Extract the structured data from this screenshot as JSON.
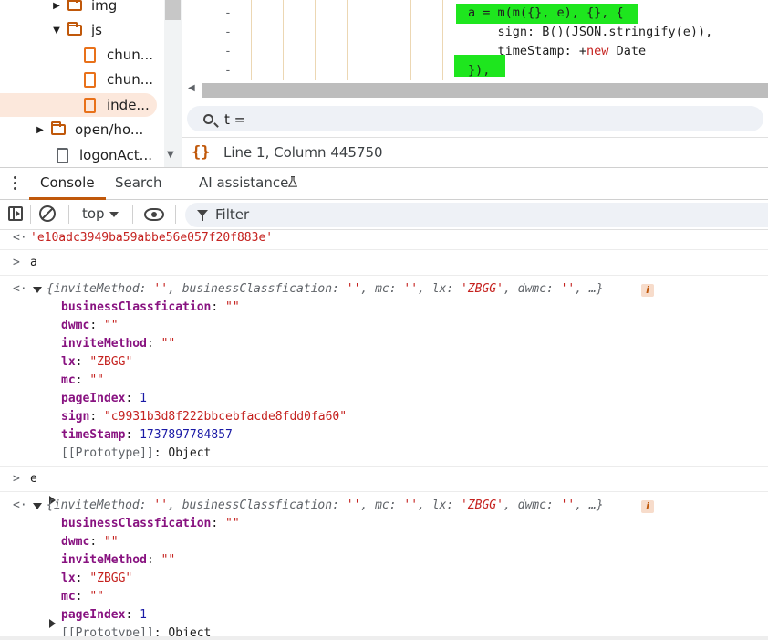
{
  "file_tree": {
    "items": [
      {
        "label": "img",
        "kind": "folder",
        "expanded": false
      },
      {
        "label": "js",
        "kind": "folder",
        "expanded": true
      },
      {
        "label": "chun...",
        "kind": "file"
      },
      {
        "label": "chun...",
        "kind": "file"
      },
      {
        "label": "inde...",
        "kind": "file",
        "selected": true
      },
      {
        "label": "open/ho...",
        "kind": "folder",
        "expanded": false
      },
      {
        "label": "logonAct...",
        "kind": "file"
      }
    ]
  },
  "editor": {
    "gutter": [
      "-",
      "-",
      "-",
      "-"
    ],
    "code_lines": [
      {
        "parts": [
          {
            "t": "a = m(m({}, e), {}, {"
          }
        ]
      },
      {
        "parts": [
          {
            "t": "    sign: B()(JSON.stringify(e)),"
          }
        ]
      },
      {
        "parts": [
          {
            "t": "    timeStamp: +"
          },
          {
            "t": "new",
            "kw": true
          },
          {
            "t": " Date"
          }
        ]
      },
      {
        "parts": [
          {
            "t": "}),"
          }
        ]
      }
    ],
    "search_query": "t =",
    "cursor_position": "Line 1, Column 445750"
  },
  "drawer": {
    "tabs": [
      "Console",
      "Search",
      "AI assistance"
    ],
    "active_tab": "Console"
  },
  "console_toolbar": {
    "context": "top",
    "filter_placeholder": "Filter"
  },
  "console": {
    "hash_result": "'e10adc3949ba59abbe56e057f20f883e'",
    "input_a": "a",
    "input_e": "e",
    "obj_a": {
      "summary": [
        {
          "k": "inviteMethod",
          "v": "''"
        },
        {
          "k": "businessClassfication",
          "v": "''"
        },
        {
          "k": "mc",
          "v": "''"
        },
        {
          "k": "lx",
          "v": "'ZBGG'"
        },
        {
          "k": "dwmc",
          "v": "''"
        }
      ],
      "summary_tail": "…}",
      "props": [
        {
          "k": "businessClassfication",
          "v": "\"\"",
          "type": "str"
        },
        {
          "k": "dwmc",
          "v": "\"\"",
          "type": "str"
        },
        {
          "k": "inviteMethod",
          "v": "\"\"",
          "type": "str"
        },
        {
          "k": "lx",
          "v": "\"ZBGG\"",
          "type": "str"
        },
        {
          "k": "mc",
          "v": "\"\"",
          "type": "str"
        },
        {
          "k": "pageIndex",
          "v": "1",
          "type": "num"
        },
        {
          "k": "sign",
          "v": "\"c9931b3d8f222bbcebfacde8fdd0fa60\"",
          "type": "str"
        },
        {
          "k": "timeStamp",
          "v": "1737897784857",
          "type": "num"
        }
      ],
      "prototype": "[[Prototype]]",
      "prototype_type": "Object"
    },
    "obj_e": {
      "summary": [
        {
          "k": "inviteMethod",
          "v": "''"
        },
        {
          "k": "businessClassfication",
          "v": "''"
        },
        {
          "k": "mc",
          "v": "''"
        },
        {
          "k": "lx",
          "v": "'ZBGG'"
        },
        {
          "k": "dwmc",
          "v": "''"
        }
      ],
      "summary_tail": "…}",
      "props": [
        {
          "k": "businessClassfication",
          "v": "\"\"",
          "type": "str"
        },
        {
          "k": "dwmc",
          "v": "\"\"",
          "type": "str"
        },
        {
          "k": "inviteMethod",
          "v": "\"\"",
          "type": "str"
        },
        {
          "k": "lx",
          "v": "\"ZBGG\"",
          "type": "str"
        },
        {
          "k": "mc",
          "v": "\"\"",
          "type": "str"
        },
        {
          "k": "pageIndex",
          "v": "1",
          "type": "num"
        }
      ],
      "prototype": "[[Prototype]]",
      "prototype_type": "Object"
    }
  },
  "colors": {
    "accent": "#c0580a",
    "highlight": "#1ee61e",
    "string": "#c5221f",
    "number": "#1a1aa6",
    "property_key": "#881280"
  },
  "icons": [
    "folder-icon",
    "file-icon",
    "search-icon",
    "braces-icon",
    "kebab-menu-icon",
    "flask-icon",
    "sidebar-toggle-icon",
    "clear-console-icon",
    "eye-icon",
    "filter-icon",
    "info-icon"
  ]
}
